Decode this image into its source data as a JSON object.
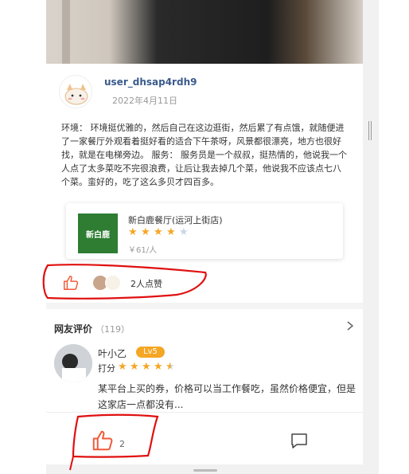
{
  "post": {
    "username": "user_dhsap4rdh9",
    "date": "2022年4月11日",
    "text": "环境：  环境挺优雅的，然后自己在这边逛街，然后累了有点饿，就随便进了一家餐厅外观看着挺好看的适合下午茶呀，风景都很漂亮，地方也很好找，就是在电梯旁边。 服务：  服务员是一个叔叔，挺热情的，他说我一个人点了太多菜吃不完很浪费，让后让我去掉几个菜，他说我不应该点七八个菜。蛮好的，吃了这么多贝才四百多。"
  },
  "shop": {
    "thumb_text": "新白鹿",
    "name": "新白鹿餐厅(运河上街店)",
    "rating": 4,
    "rating_max": 5,
    "price": "￥61/人"
  },
  "likes": {
    "label": "2人点赞"
  },
  "comments": {
    "title": "网友评价",
    "count": "（119）",
    "items": [
      {
        "name": "叶小乙",
        "level": "Lv5",
        "score_label": "打分",
        "rating": 4.5,
        "text": "某平台上买的券，价格可以当工作餐吃，虽然价格便宜，但是这家店一点都没有..."
      }
    ]
  },
  "bottom_bar": {
    "like_count": "2"
  },
  "icons": {
    "like": "thumbs-up-icon",
    "comment": "comment-icon",
    "chevron": "chevron-right-icon"
  },
  "colors": {
    "accent": "#f05a3a",
    "star": "#f5a623",
    "username": "#3a5a8c",
    "annotation": "#e01010"
  }
}
